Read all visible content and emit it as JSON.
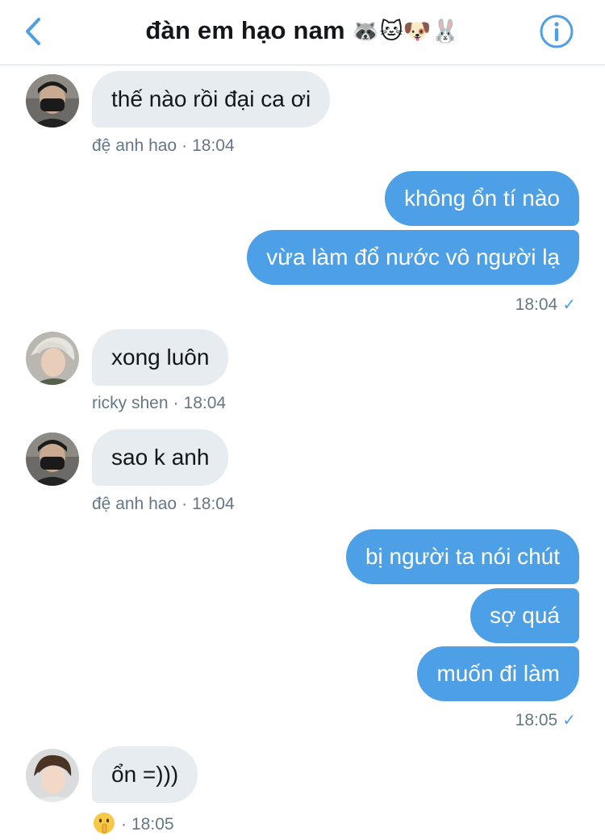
{
  "header": {
    "back_icon": "chevron-left-icon",
    "title": "đàn em hạo nam",
    "title_emojis": "🦝🐱🐶🐰",
    "info_icon": "info-icon",
    "accent": "#4d9fe6"
  },
  "messages": [
    {
      "text": "thế nào rồi đại ca ơi",
      "sender": "đệ anh hao",
      "time": "18:04"
    },
    {
      "text": "không ổn tí nào"
    },
    {
      "text": "vừa làm đổ nước vô người lạ",
      "time": "18:04"
    },
    {
      "text": "xong luôn",
      "sender": "ricky shen",
      "time": "18:04"
    },
    {
      "text": "sao k anh",
      "sender": "đệ anh hao",
      "time": "18:04"
    },
    {
      "text": "bị người ta nói chút"
    },
    {
      "text": "sợ quá"
    },
    {
      "text": "muốn đi làm",
      "time": "18:05"
    },
    {
      "text": "ổn =)))",
      "reaction": "shushing-face-emoji",
      "time": "18:05"
    }
  ],
  "meta": {
    "separator": "·",
    "read_check": "✓"
  },
  "colors": {
    "incoming_bubble": "#e6ecf0",
    "outgoing_bubble": "#4d9fe6",
    "meta_text": "#657786"
  }
}
